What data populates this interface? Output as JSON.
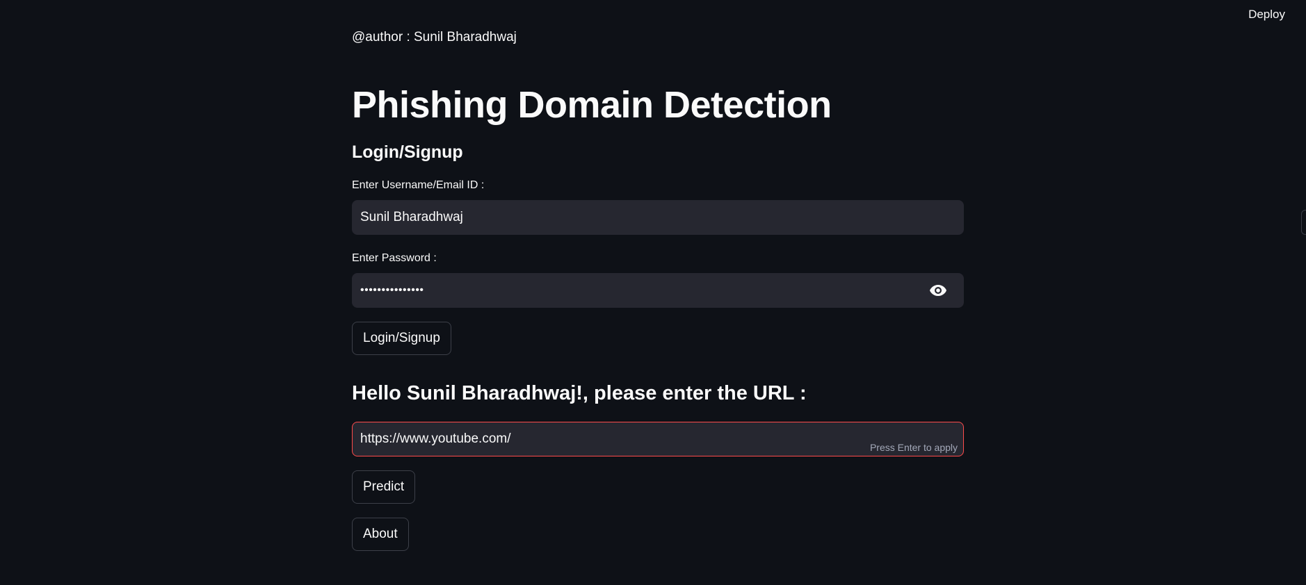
{
  "header": {
    "deploy_label": "Deploy"
  },
  "main": {
    "author": "@author : Sunil Bharadhwaj",
    "title": "Phishing Domain Detection",
    "section_title": "Login/Signup",
    "username": {
      "label": "Enter Username/Email ID :",
      "value": "Sunil Bharadhwaj"
    },
    "password": {
      "label": "Enter Password :",
      "value": "•••••••••••••••",
      "toggle_icon": "eye-icon"
    },
    "login_button": "Login/Signup",
    "greeting": "Hello Sunil Bharadhwaj!, please enter the URL :",
    "url": {
      "value": "https://www.youtube.com/",
      "hint": "Press Enter to apply",
      "focus_border_color": "#ff4b4b"
    },
    "predict_button": "Predict",
    "about_button": "About"
  },
  "theme": {
    "background": "#0e1117",
    "input_background": "#262730",
    "text": "#fafafa"
  }
}
